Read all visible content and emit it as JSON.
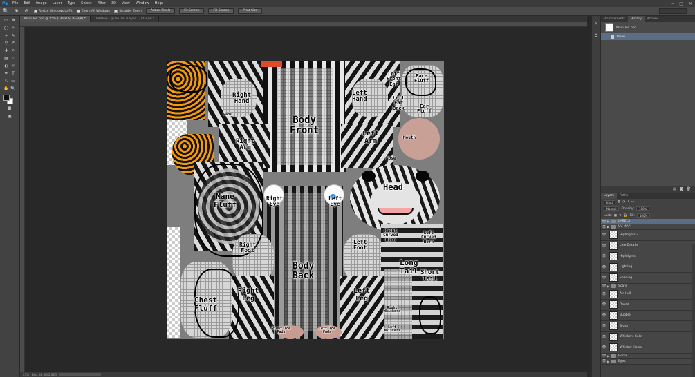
{
  "app": {
    "logo": "Ps"
  },
  "menu": [
    "File",
    "Edit",
    "Image",
    "Layer",
    "Type",
    "Select",
    "Filter",
    "3D",
    "View",
    "Window",
    "Help"
  ],
  "window_controls": {
    "minimize": "–",
    "maximize": "□",
    "close": "✕"
  },
  "options": {
    "zoom_icon": "🔍",
    "resize_windows": "Resize Windows to Fit",
    "zoom_all": "Zoom All Windows",
    "scrubby_zoom": "Scrubby Zoom",
    "actual_pixels": "Actual Pixels",
    "fit_screen": "Fit Screen",
    "fill_screen": "Fill Screen",
    "print_size": "Print Size"
  },
  "tabs": [
    {
      "label": "Main Tex.psd @ 25% (LABELS, RGB/8) *",
      "active": true
    },
    {
      "label": "Untitled-1 @ 66.7% (Layer 1, RGB/8) *",
      "active": false
    }
  ],
  "tools": [
    [
      "▭",
      "✥"
    ],
    [
      "◯",
      "✧"
    ],
    [
      "⌗",
      "✎"
    ],
    [
      "⚲",
      "✐"
    ],
    [
      "✚",
      "✍"
    ],
    [
      "▤",
      "♨"
    ],
    [
      "◐",
      "☼"
    ],
    [
      "✒",
      "T"
    ],
    [
      "↖",
      "▭"
    ],
    [
      "✋",
      "🔍"
    ]
  ],
  "canvas_labels": {
    "right_hand": "Right\nHand",
    "left_hand": "Left\nHand",
    "body_front": "Body\nFront",
    "right_arm": "Right\nArm",
    "left_arm": "Left\nArm",
    "head": "Head",
    "mane_fluff": "Mane\nFluff",
    "right_eye": "Right\nEye",
    "left_eye": "Left\nEye",
    "right_foot": "Right\nFoot",
    "left_foot": "Left\nFoot",
    "body_back": "Body\nBack",
    "long_tail": "Long\nTail",
    "short_tail": "Short\nTail",
    "chest_fluff": "Chest\nFluff",
    "right_leg": "Right\nLeg",
    "left_leg": "Left\nLeg",
    "face_fluff": "Face\nFluff",
    "ear_fluff": "Ear\nFluff",
    "left_front_ear": "Left\nFront\nEar",
    "left_ear_back": "Left\nEar\nBack",
    "mouth": "Mouth",
    "nose": "Nose",
    "left_curved_horn": "Left\nCurved\nHorn",
    "right_curved_horn": "Right\nCurved\nHorn",
    "right_whiskers": "Right\nWhiskers",
    "left_whiskers": "Left\nWhiskers",
    "right_toe_pads": "Right Toe\nPads",
    "left_toe_pads": "Left Toe\nPads",
    "hand_pads": "Pads"
  },
  "status": {
    "zoom": "25%",
    "doc": "Doc: 48.0M/2.38G"
  },
  "history_panel": {
    "tabs": [
      "Brush Presets",
      "History",
      "Actions"
    ],
    "active_tab": "History",
    "snapshot": "Main Tex.psd",
    "states": [
      "Open"
    ]
  },
  "layers_panel": {
    "tabs": [
      "Layers",
      "Paths"
    ],
    "filter_kind": "Kind",
    "blend_mode": "Normal",
    "opacity_label": "Opacity:",
    "opacity_value": "100%",
    "lock_label": "Lock:",
    "fill_label": "Fill:",
    "fill_value": "100%",
    "layers": [
      {
        "name": "LABELS",
        "type": "group",
        "selected": true
      },
      {
        "name": "UV MAP",
        "type": "group",
        "selected": false
      },
      {
        "name": "Highlights 2",
        "type": "layer",
        "selected": false
      },
      {
        "name": "Line Details",
        "type": "layer",
        "selected": false
      },
      {
        "name": "Highlights",
        "type": "layer",
        "selected": false
      },
      {
        "name": "Lighting",
        "type": "layer",
        "selected": false
      },
      {
        "name": "Shading",
        "type": "layer",
        "selected": false
      },
      {
        "name": "Scars",
        "type": "group",
        "selected": false
      },
      {
        "name": "Air Hull",
        "type": "layer",
        "selected": false
      },
      {
        "name": "Dread",
        "type": "layer",
        "selected": false
      },
      {
        "name": "Bubble",
        "type": "layer",
        "selected": false
      },
      {
        "name": "Blush",
        "type": "layer",
        "selected": false
      },
      {
        "name": "Whiskers Color",
        "type": "layer",
        "selected": false
      },
      {
        "name": "Whisker Holes",
        "type": "layer",
        "selected": false
      },
      {
        "name": "Horns",
        "type": "group",
        "selected": false
      },
      {
        "name": "Eyes",
        "type": "group",
        "selected": false
      }
    ]
  },
  "colors": {
    "selection": "#5a6e86",
    "ps_blue": "#31a8ff"
  }
}
